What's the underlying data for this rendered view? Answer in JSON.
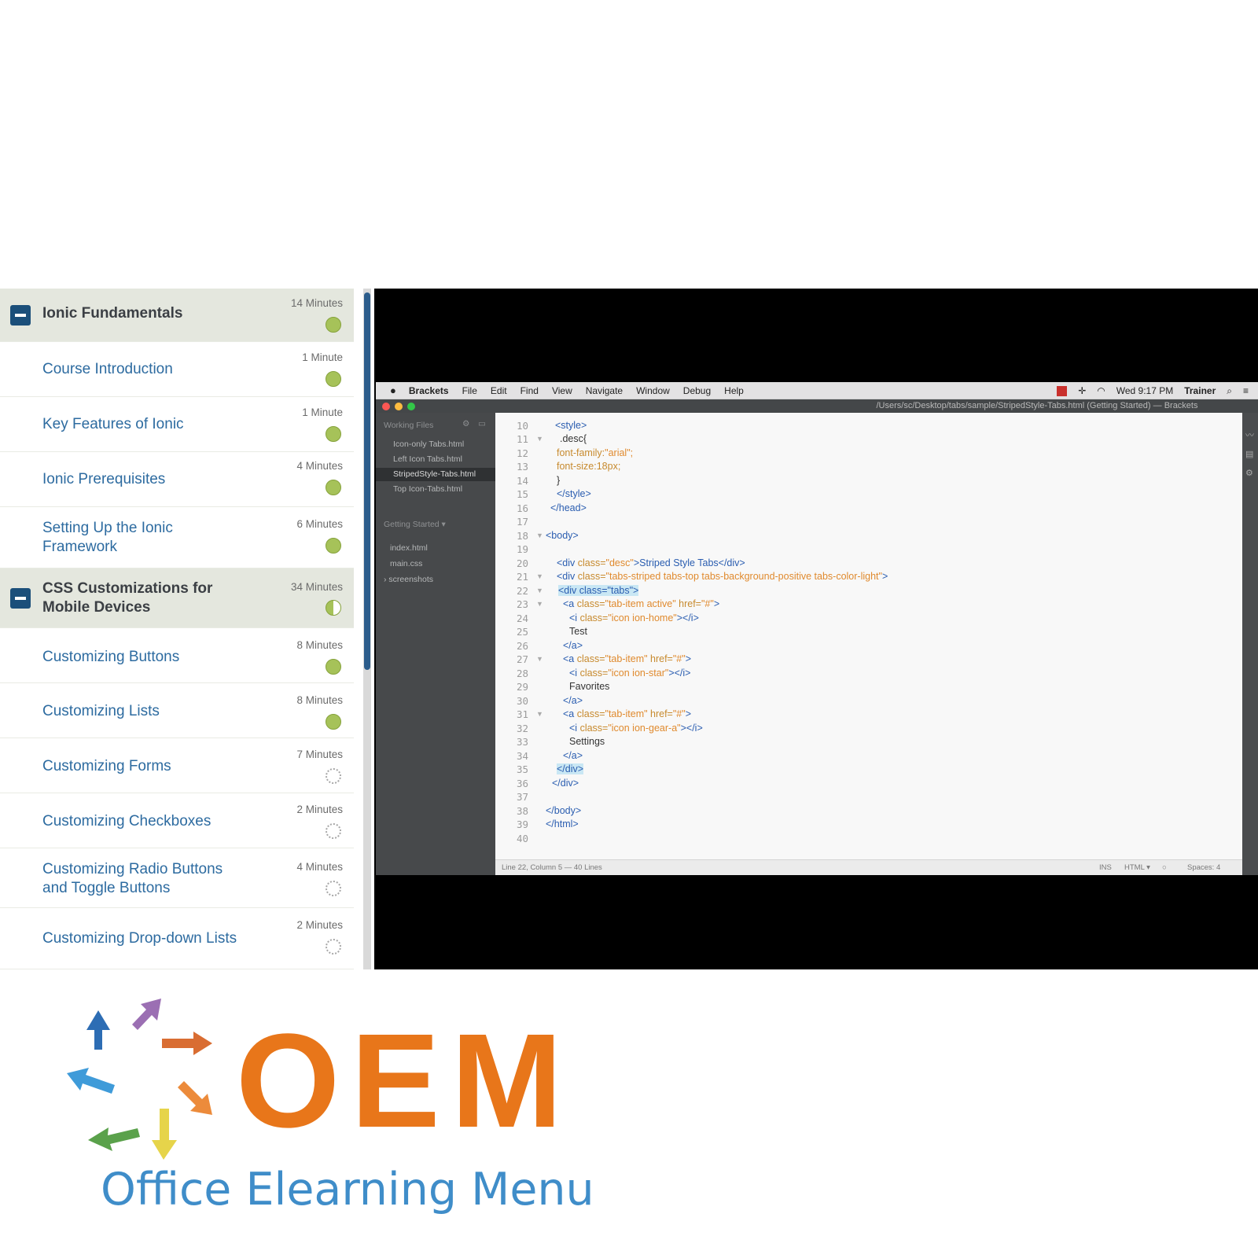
{
  "course": {
    "sections": [
      {
        "title": "Ionic Fundamentals",
        "duration": "14 Minutes",
        "status": "complete",
        "lessons": [
          {
            "title": "Course Introduction",
            "duration": "1 Minute",
            "status": "complete"
          },
          {
            "title": "Key Features of Ionic",
            "duration": "1 Minute",
            "status": "complete"
          },
          {
            "title": "Ionic Prerequisites",
            "duration": "4 Minutes",
            "status": "complete"
          },
          {
            "title_line1": "Setting Up the Ionic",
            "title_line2": "Framework",
            "duration": "6 Minutes",
            "status": "complete"
          }
        ]
      },
      {
        "title_line1": "CSS Customizations for",
        "title_line2": "Mobile Devices",
        "duration": "34 Minutes",
        "status": "partial",
        "lessons": [
          {
            "title": "Customizing Buttons",
            "duration": "8 Minutes",
            "status": "complete"
          },
          {
            "title": "Customizing Lists",
            "duration": "8 Minutes",
            "status": "complete"
          },
          {
            "title": "Customizing Forms",
            "duration": "7 Minutes",
            "status": "not-started"
          },
          {
            "title": "Customizing Checkboxes",
            "duration": "2 Minutes",
            "status": "not-started"
          },
          {
            "title_line1": "Customizing Radio Buttons",
            "title_line2": "and Toggle Buttons",
            "duration": "4 Minutes",
            "status": "not-started"
          },
          {
            "title": "Customizing Drop-down Lists",
            "duration": "2 Minutes",
            "status": "not-started"
          }
        ]
      }
    ]
  },
  "video": {
    "menubar": {
      "app": "Brackets",
      "menus": [
        "File",
        "Edit",
        "Find",
        "View",
        "Navigate",
        "Window",
        "Debug",
        "Help"
      ],
      "clock": "Wed 9:17 PM",
      "user": "Trainer"
    },
    "window_title": "/Users/sc/Desktop/tabs/sample/StripedStyle-Tabs.html (Getting Started) — Brackets",
    "file_tree": {
      "working_files_label": "Working Files",
      "working_files": [
        "Icon-only Tabs.html",
        "Left Icon Tabs.html",
        "StripedStyle-Tabs.html",
        "Top Icon-Tabs.html"
      ],
      "selected_file": "StripedStyle-Tabs.html",
      "project_label": "Getting Started ▾",
      "project_files": [
        "index.html",
        "main.css",
        "› screenshots"
      ]
    },
    "code_lines": {
      "l10": "<style>",
      "l11": ".desc{",
      "l12_prop": "font-family:",
      "l12_val": "\"arial\";",
      "l13": "font-size:18px;",
      "l14": "}",
      "l15": "</style>",
      "l16": "</head>",
      "l18": "<body>",
      "l20_open": "<div ",
      "l20_attr": "class=",
      "l20_val": "\"desc\"",
      "l20_text": ">Striped Style Tabs</div>",
      "l21_open": "<div ",
      "l21_attr": "class=",
      "l21_val": "\"tabs-striped tabs-top tabs-background-positive tabs-color-light\"",
      "l21_close": ">",
      "l22": "<div class=\"tabs\">",
      "l23_open": "<a ",
      "l23_attr": "class=",
      "l23_val": "\"tab-item active\"",
      "l23_attr2": " href=",
      "l23_val2": "\"#\"",
      "l23_close": ">",
      "l24_open": "<i ",
      "l24_attr": "class=",
      "l24_val": "\"icon ion-home\"",
      "l24_close": "></i>",
      "l25": "Test",
      "l26": "</a>",
      "l27_open": "<a ",
      "l27_attr": "class=",
      "l27_val": "\"tab-item\"",
      "l27_attr2": " href=",
      "l27_val2": "\"#\"",
      "l27_close": ">",
      "l28_open": "<i ",
      "l28_attr": "class=",
      "l28_val": "\"icon ion-star\"",
      "l28_close": "></i>",
      "l29": "Favorites",
      "l30": "</a>",
      "l31_open": "<a ",
      "l31_attr": "class=",
      "l31_val": "\"tab-item\"",
      "l31_attr2": " href=",
      "l31_val2": "\"#\"",
      "l31_close": ">",
      "l32_open": "<i ",
      "l32_attr": "class=",
      "l32_val": "\"icon ion-gear-a\"",
      "l32_close": "></i>",
      "l33": "Settings",
      "l34": "</a>",
      "l35": "</div>",
      "l36": "</div>",
      "l38": "</body>",
      "l39": "</html>"
    },
    "status_bar": {
      "cursor": "Line 22, Column 5 — 40 Lines",
      "ins": "INS",
      "mode": "HTML ▾",
      "spaces": "Spaces: 4"
    }
  },
  "brand": {
    "mark": "OEM",
    "tagline": "Office Elearning Menu"
  },
  "colors": {
    "section_bg": "#e4e7de",
    "lesson_link": "#2d6ba0",
    "status_complete": "#a6c259",
    "brand_orange": "#e8761a",
    "brand_blue": "#3f8dc9"
  }
}
